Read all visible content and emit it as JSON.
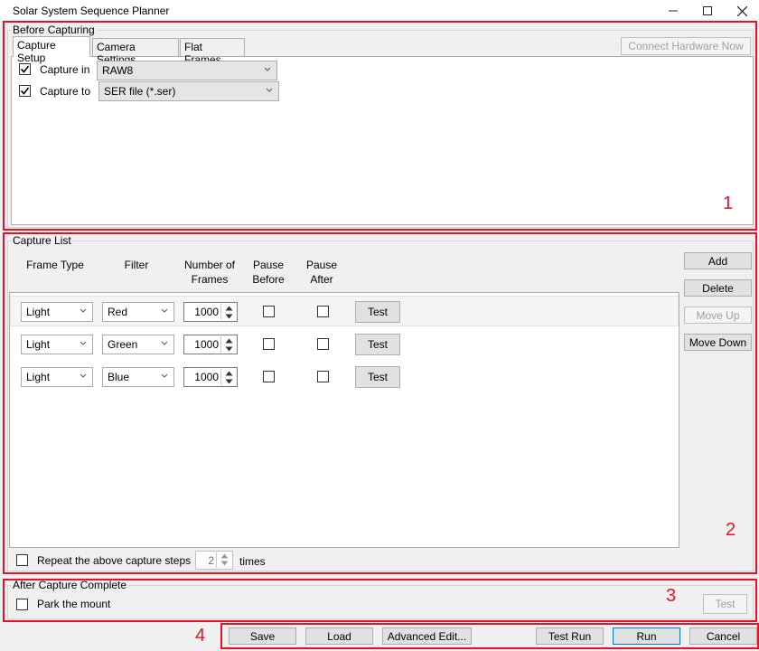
{
  "window": {
    "title": "Solar System Sequence Planner",
    "controls": [
      "minimize-icon",
      "maximize-icon",
      "close-icon"
    ]
  },
  "before_capturing": {
    "legend": "Before Capturing",
    "tabs": [
      "Capture Setup",
      "Camera Settings",
      "Flat Frames"
    ],
    "active_tab": "Capture Setup",
    "connect_button": "Connect Hardware Now",
    "capture_in": {
      "label": "Capture in",
      "checked": true,
      "value": "RAW8"
    },
    "capture_to": {
      "label": "Capture to",
      "checked": true,
      "value": "SER file (*.ser)"
    }
  },
  "capture_list": {
    "legend": "Capture List",
    "headers": {
      "frame_type": "Frame Type",
      "filter": "Filter",
      "num_frames_1": "Number of",
      "num_frames_2": "Frames",
      "pause_before_1": "Pause",
      "pause_before_2": "Before",
      "pause_after_1": "Pause",
      "pause_after_2": "After"
    },
    "rows": [
      {
        "frame_type": "Light",
        "filter": "Red",
        "frames": "1000",
        "pause_before": false,
        "pause_after": false,
        "test": "Test"
      },
      {
        "frame_type": "Light",
        "filter": "Green",
        "frames": "1000",
        "pause_before": false,
        "pause_after": false,
        "test": "Test"
      },
      {
        "frame_type": "Light",
        "filter": "Blue",
        "frames": "1000",
        "pause_before": false,
        "pause_after": false,
        "test": "Test"
      }
    ],
    "side_buttons": {
      "add": "Add",
      "delete": "Delete",
      "move_up": "Move Up",
      "move_down": "Move Down"
    },
    "repeat": {
      "label": "Repeat the above capture steps",
      "value": "2",
      "suffix": "times",
      "checked": false
    }
  },
  "after_capture": {
    "legend": "After Capture Complete",
    "park": {
      "label": "Park the mount",
      "checked": false
    },
    "test_button": "Test"
  },
  "footer": {
    "save": "Save",
    "load": "Load",
    "advanced": "Advanced Edit...",
    "test_run": "Test Run",
    "run": "Run",
    "cancel": "Cancel"
  },
  "annotations": {
    "n1": "1",
    "n2": "2",
    "n3": "3",
    "n4": "4",
    "color": "#e81123"
  }
}
